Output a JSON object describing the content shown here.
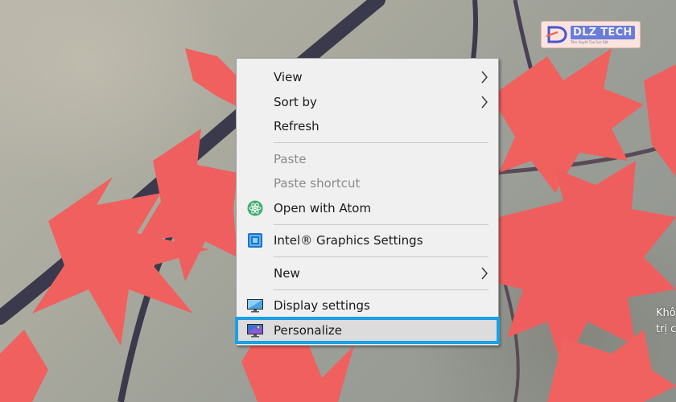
{
  "logo": {
    "name": "DLZ TECH",
    "tagline": "Tâm Huyết Tạo Sức Bật"
  },
  "side_text": [
    "Khô",
    "trị c"
  ],
  "context_menu": {
    "items": [
      {
        "label": "View",
        "has_submenu": true,
        "enabled": true
      },
      {
        "label": "Sort by",
        "has_submenu": true,
        "enabled": true
      },
      {
        "label": "Refresh",
        "has_submenu": false,
        "enabled": true
      },
      {
        "label": "Paste",
        "has_submenu": false,
        "enabled": false
      },
      {
        "label": "Paste shortcut",
        "has_submenu": false,
        "enabled": false
      },
      {
        "label": "Open with Atom",
        "icon": "atom-icon",
        "enabled": true
      },
      {
        "label": "Intel® Graphics Settings",
        "icon": "intel-graphics-icon",
        "enabled": true
      },
      {
        "label": "New",
        "has_submenu": true,
        "enabled": true
      },
      {
        "label": "Display settings",
        "icon": "display-icon",
        "enabled": true
      },
      {
        "label": "Personalize",
        "icon": "personalize-icon",
        "enabled": true,
        "highlighted": true
      }
    ]
  },
  "colors": {
    "highlight_border": "#1ba0e6",
    "menu_background": "#f0f0f0",
    "leaf_red": "#f0605f"
  }
}
